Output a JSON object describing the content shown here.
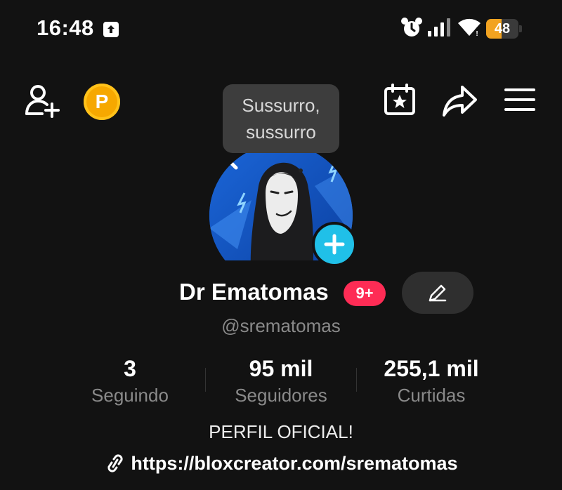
{
  "status_bar": {
    "time": "16:48",
    "battery_percent": "48",
    "battery_level": 0.48,
    "icons": [
      "upload-icon",
      "alarm-icon",
      "signal-icon",
      "wifi-icon",
      "battery-icon"
    ]
  },
  "top_nav": {
    "icons": [
      "add-friend-icon",
      "coin-icon",
      "calendar-star-icon",
      "share-icon",
      "menu-icon"
    ],
    "coin_letter": "P",
    "coin_color": "#f6a800"
  },
  "tooltip": {
    "line1": "Sussurro,",
    "line2": "sussurro"
  },
  "profile": {
    "display_name": "Dr Ematomas",
    "notification_badge": "9+",
    "username": "@srematomas",
    "bio": "PERFIL OFICIAL!",
    "link": "https://bloxcreator.com/srematomas",
    "badge_color": "#fe2c55",
    "accent_color": "#20c0e8"
  },
  "stats": [
    {
      "value": "3",
      "label": "Seguindo"
    },
    {
      "value": "95 mil",
      "label": "Seguidores"
    },
    {
      "value": "255,1 mil",
      "label": "Curtidas"
    }
  ]
}
